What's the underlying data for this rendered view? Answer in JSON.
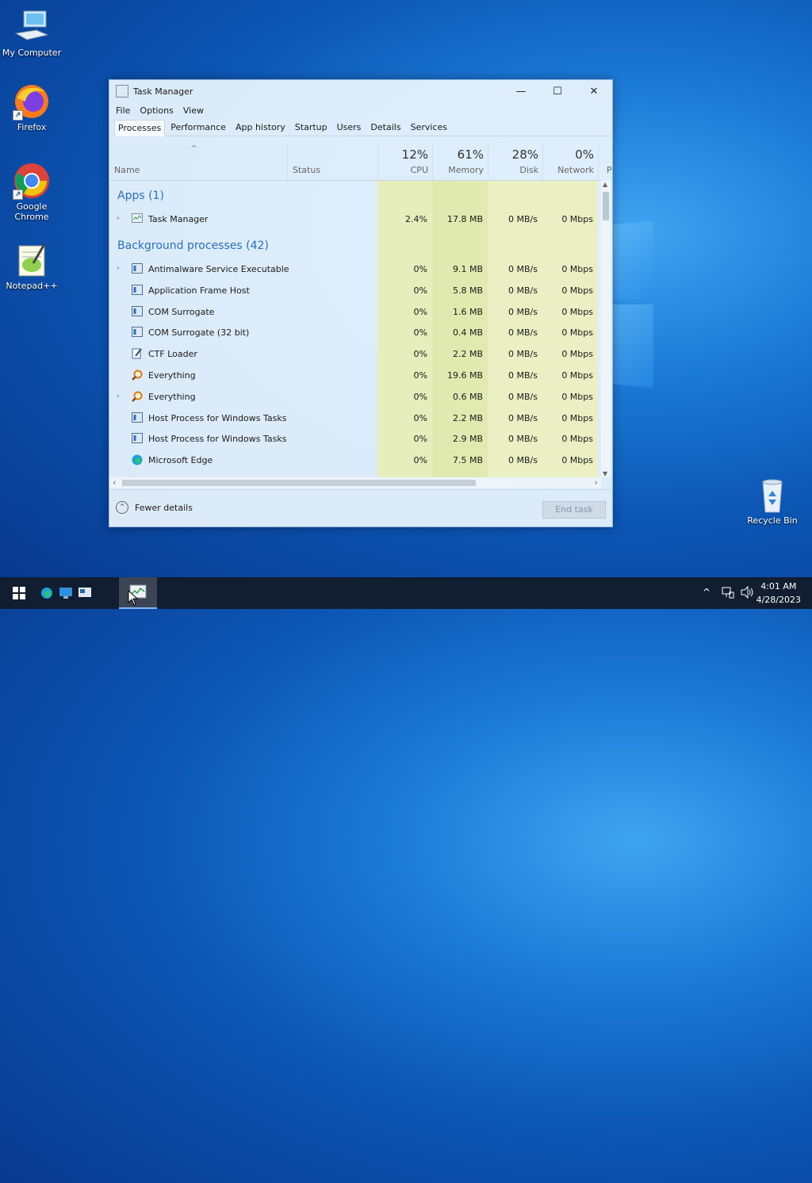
{
  "desktop": {
    "icons": [
      {
        "label": "My Computer"
      },
      {
        "label": "Firefox"
      },
      {
        "label": "Google Chrome"
      },
      {
        "label": "Notepad++"
      },
      {
        "label": "Recycle Bin"
      }
    ]
  },
  "task_manager": {
    "title": "Task Manager",
    "menu": [
      "File",
      "Options",
      "View"
    ],
    "tabs": [
      "Processes",
      "Performance",
      "App history",
      "Startup",
      "Users",
      "Details",
      "Services"
    ],
    "active_tab": "Processes",
    "columns": {
      "name": "Name",
      "status": "Status",
      "cpu": {
        "pct": "12%",
        "label": "CPU"
      },
      "memory": {
        "pct": "61%",
        "label": "Memory"
      },
      "disk": {
        "pct": "28%",
        "label": "Disk"
      },
      "network": {
        "pct": "0%",
        "label": "Network"
      },
      "power": "P"
    },
    "groups": {
      "apps": "Apps (1)",
      "background": "Background processes (42)"
    },
    "apps": [
      {
        "name": "Task Manager",
        "cpu": "2.4%",
        "memory": "17.8 MB",
        "disk": "0 MB/s",
        "network": "0 Mbps",
        "expandable": true,
        "icon": "task-manager-icon"
      }
    ],
    "background": [
      {
        "name": "Antimalware Service Executable",
        "cpu": "0%",
        "memory": "9.1 MB",
        "disk": "0 MB/s",
        "network": "0 Mbps",
        "expandable": true,
        "icon": "service-icon"
      },
      {
        "name": "Application Frame Host",
        "cpu": "0%",
        "memory": "5.8 MB",
        "disk": "0 MB/s",
        "network": "0 Mbps",
        "expandable": false,
        "icon": "service-icon"
      },
      {
        "name": "COM Surrogate",
        "cpu": "0%",
        "memory": "1.6 MB",
        "disk": "0 MB/s",
        "network": "0 Mbps",
        "expandable": false,
        "icon": "service-icon"
      },
      {
        "name": "COM Surrogate (32 bit)",
        "cpu": "0%",
        "memory": "0.4 MB",
        "disk": "0 MB/s",
        "network": "0 Mbps",
        "expandable": false,
        "icon": "service-icon"
      },
      {
        "name": "CTF Loader",
        "cpu": "0%",
        "memory": "2.2 MB",
        "disk": "0 MB/s",
        "network": "0 Mbps",
        "expandable": false,
        "icon": "ctf-loader-icon"
      },
      {
        "name": "Everything",
        "cpu": "0%",
        "memory": "19.6 MB",
        "disk": "0 MB/s",
        "network": "0 Mbps",
        "expandable": false,
        "icon": "everything-search-icon"
      },
      {
        "name": "Everything",
        "cpu": "0%",
        "memory": "0.6 MB",
        "disk": "0 MB/s",
        "network": "0 Mbps",
        "expandable": true,
        "icon": "everything-search-icon"
      },
      {
        "name": "Host Process for Windows Tasks",
        "cpu": "0%",
        "memory": "2.2 MB",
        "disk": "0 MB/s",
        "network": "0 Mbps",
        "expandable": false,
        "icon": "service-icon"
      },
      {
        "name": "Host Process for Windows Tasks",
        "cpu": "0%",
        "memory": "2.9 MB",
        "disk": "0 MB/s",
        "network": "0 Mbps",
        "expandable": false,
        "icon": "service-icon"
      },
      {
        "name": "Microsoft Edge",
        "cpu": "0%",
        "memory": "7.5 MB",
        "disk": "0 MB/s",
        "network": "0 Mbps",
        "expandable": false,
        "icon": "edge-icon"
      }
    ],
    "footer": {
      "fewer_details": "Fewer details",
      "end_task": "End task"
    }
  },
  "taskbar": {
    "time": "4:01 AM",
    "date": "4/28/2023"
  },
  "colors": {
    "accent": "#2a6fc4",
    "heat_light": "#eef3c8",
    "heat_mid": "#e3ecb0",
    "taskbar": "#121c2c"
  }
}
